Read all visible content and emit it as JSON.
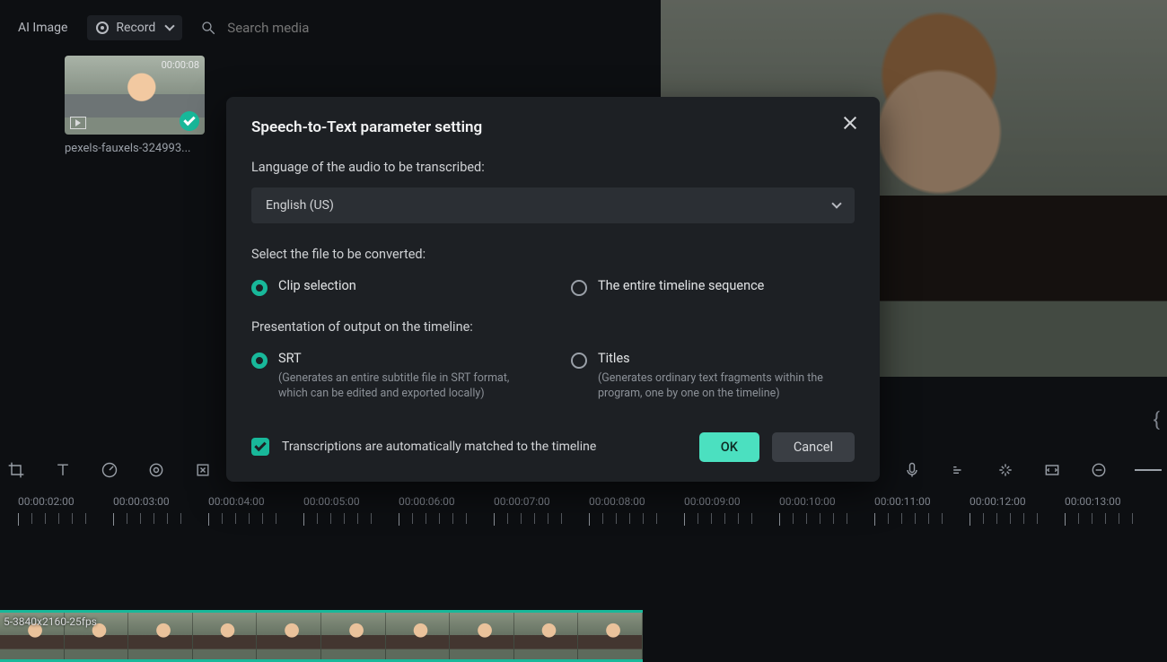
{
  "topbar": {
    "ai_image_label": "AI Image",
    "record_label": "Record",
    "search_placeholder": "Search media"
  },
  "media": {
    "thumb_timecode": "00:00:08",
    "thumb_filename": "pexels-fauxels-324993..."
  },
  "timeline": {
    "marks": [
      "00:00:02:00",
      "00:00:03:00",
      "00:00:04:00",
      "00:00:05:00",
      "00:00:06:00",
      "00:00:07:00",
      "00:00:08:00",
      "00:00:09:00",
      "00:00:10:00",
      "00:00:11:00",
      "00:00:12:00",
      "00:00:13:00"
    ],
    "clip_spec": "5-3840x2160-25fps"
  },
  "dialog": {
    "title": "Speech-to-Text parameter setting",
    "lang_label": "Language of the audio to be transcribed:",
    "lang_value": "English (US)",
    "file_label": "Select the file to be converted:",
    "radio_file": {
      "clip": "Clip selection",
      "entire": "The entire timeline sequence"
    },
    "output_label": "Presentation of output on the timeline:",
    "radio_output": {
      "srt_title": "SRT",
      "srt_desc": "(Generates an entire subtitle file in SRT format, which can be edited and exported locally)",
      "titles_title": "Titles",
      "titles_desc": "(Generates ordinary text fragments within the program, one by one on the timeline)"
    },
    "checkbox_label": "Transcriptions are automatically matched to the timeline",
    "ok_label": "OK",
    "cancel_label": "Cancel"
  }
}
